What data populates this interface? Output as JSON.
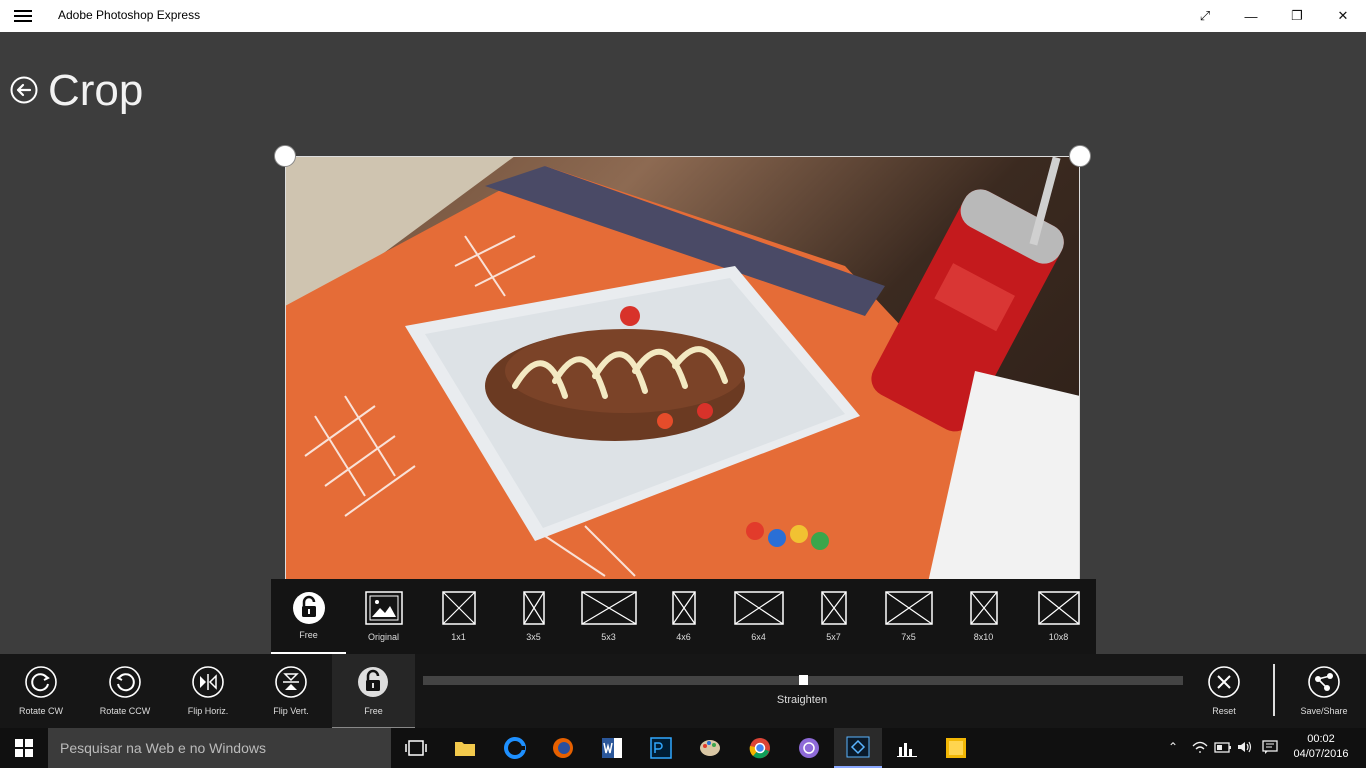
{
  "app": {
    "title": "Adobe Photoshop Express"
  },
  "window": {
    "maximize_glyph": "⤢",
    "minimize_glyph": "—",
    "restore_glyph": "❐",
    "close_glyph": "✕"
  },
  "page": {
    "title": "Crop"
  },
  "aspect_ratios": [
    {
      "label": "Free",
      "icon": "lock-open-icon",
      "selected": true
    },
    {
      "label": "Original",
      "icon": "image-icon"
    },
    {
      "label": "1x1",
      "icon": "ratio-icon"
    },
    {
      "label": "3x5",
      "icon": "ratio-icon"
    },
    {
      "label": "5x3",
      "icon": "ratio-icon"
    },
    {
      "label": "4x6",
      "icon": "ratio-icon"
    },
    {
      "label": "6x4",
      "icon": "ratio-icon"
    },
    {
      "label": "5x7",
      "icon": "ratio-icon"
    },
    {
      "label": "7x5",
      "icon": "ratio-icon"
    },
    {
      "label": "8x10",
      "icon": "ratio-icon"
    },
    {
      "label": "10x8",
      "icon": "ratio-icon"
    }
  ],
  "tools": {
    "rotate_cw": "Rotate CW",
    "rotate_ccw": "Rotate CCW",
    "flip_horiz": "Flip Horiz.",
    "flip_vert": "Flip Vert.",
    "free": "Free",
    "straighten": "Straighten",
    "straighten_value": 0.5,
    "reset": "Reset",
    "save_share": "Save/Share"
  },
  "taskbar": {
    "search_placeholder": "Pesquisar na Web e no Windows",
    "time": "00:02",
    "date": "04/07/2016",
    "colors": {
      "accent": "#8aa8ff",
      "word": "#2b579a",
      "photoshop": "#001d34",
      "chrome": "#4285f4"
    }
  }
}
